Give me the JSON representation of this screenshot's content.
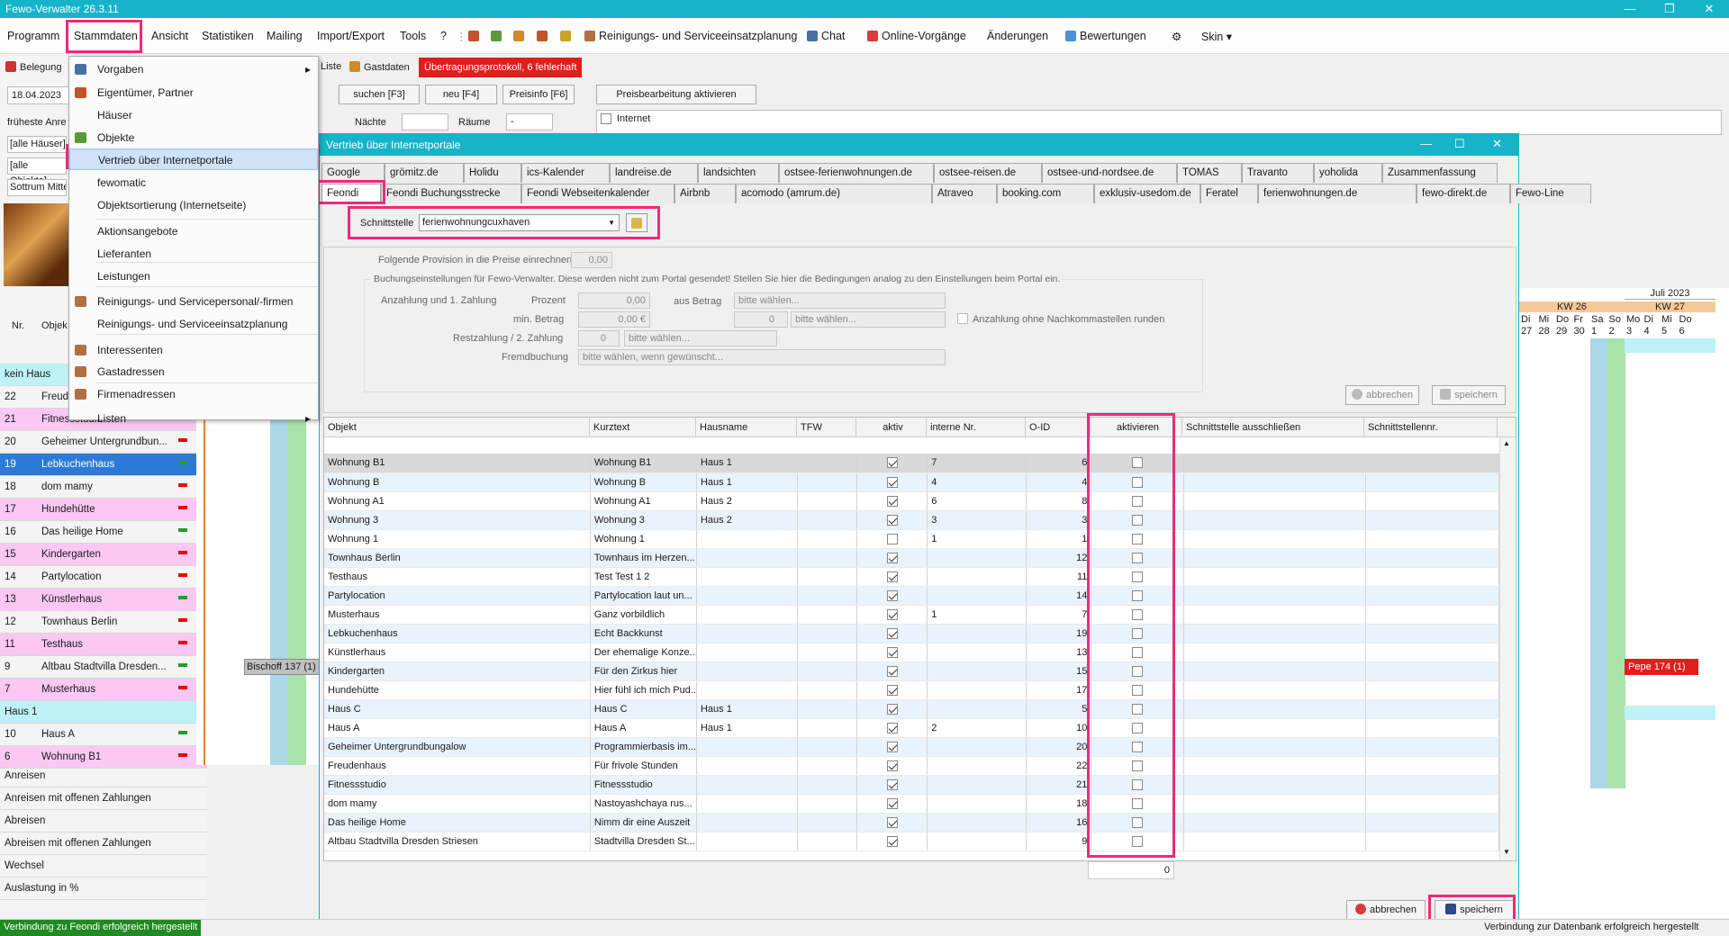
{
  "app": {
    "title": "Fewo-Verwalter 26.3.11"
  },
  "menu": {
    "items": [
      "Programm",
      "Stammdaten",
      "Ansicht",
      "Statistiken",
      "Mailing",
      "Import/Export",
      "Tools",
      "?"
    ],
    "reinigung": "Reinigungs- und Serviceeinsatzplanung",
    "chat": "Chat",
    "online": "Online-Vorgänge",
    "aenderungen": "Änderungen",
    "bewertungen": "Bewertungen",
    "skin": "Skin"
  },
  "dropdown": [
    {
      "label": "Vorgaben",
      "arrow": true,
      "icon": true
    },
    {
      "label": "Eigentümer, Partner",
      "icon": true
    },
    {
      "label": "Häuser"
    },
    {
      "label": "Objekte",
      "icon": true
    },
    {
      "label": "Vertrieb über Internetportale",
      "selected": true
    },
    {
      "label": "fewomatic"
    },
    {
      "label": "Objektsortierung (Internetseite)"
    },
    {
      "label": "Aktionsangebote"
    },
    {
      "label": "Lieferanten"
    },
    {
      "label": "Leistungen"
    },
    {
      "label": "Reinigungs- und Servicepersonal/-firmen",
      "icon": true
    },
    {
      "label": "Reinigungs- und Serviceeinsatzplanung"
    },
    {
      "label": "Interessenten",
      "icon": true
    },
    {
      "label": "Gastadressen",
      "icon": true
    },
    {
      "label": "Firmenadressen",
      "icon": true
    },
    {
      "label": "Listen",
      "arrow": true
    }
  ],
  "left": {
    "belegung": "Belegung",
    "date": "18.04.2023",
    "frueheste": "früheste Anre",
    "haeuser": "[alle Häuser]",
    "objekte": "[alle Objekte]",
    "sottrum": "Sottrum Mitte",
    "col_nr": "Nr.",
    "col_obj": "Objek"
  },
  "toolbar2": {
    "liste": "Liste",
    "gastdaten": "Gastdaten",
    "protokoll": "Übertragungsprotokoll, 6 fehlerhaft",
    "suchen": "suchen [F3]",
    "neu": "neu [F4]",
    "preisinfo": "Preisinfo [F6]",
    "preisbearbeitung": "Preisbearbeitung aktivieren",
    "naechte": "Nächte",
    "raeume": "Räume",
    "raeume_val": "-",
    "internet": "Internet"
  },
  "rows": [
    {
      "label": "kein Haus",
      "group": true
    },
    {
      "n": "22",
      "o": "Freud"
    },
    {
      "n": "21",
      "o": "Fitnessstudio",
      "pink": true
    },
    {
      "n": "20",
      "o": "Geheimer Untergrundbun..."
    },
    {
      "n": "19",
      "o": "Lebkuchenhaus",
      "sel": true
    },
    {
      "n": "18",
      "o": "dom mamy"
    },
    {
      "n": "17",
      "o": "Hundehütte",
      "pink": true
    },
    {
      "n": "16",
      "o": "Das heilige Home"
    },
    {
      "n": "15",
      "o": "Kindergarten",
      "pink": true
    },
    {
      "n": "14",
      "o": "Partylocation"
    },
    {
      "n": "13",
      "o": "Künstlerhaus",
      "pink": true
    },
    {
      "n": "12",
      "o": "Townhaus Berlin"
    },
    {
      "n": "11",
      "o": "Testhaus",
      "pink": true
    },
    {
      "n": "9",
      "o": "Altbau Stadtvilla Dresden..."
    },
    {
      "n": "7",
      "o": "Musterhaus",
      "pink": true
    },
    {
      "label": "Haus 1",
      "group": true
    },
    {
      "n": "10",
      "o": "Haus A"
    },
    {
      "n": "6",
      "o": "Wohnung B1",
      "pink": true
    }
  ],
  "stats": [
    "Anreisen",
    "Anreisen mit offenen Zahlungen",
    "Abreisen",
    "Abreisen mit offenen Zahlungen",
    "Wechsel",
    "Auslastung in %"
  ],
  "booking_bar": "Bischoff 137 (1)",
  "pepe": "Pepe  174 (1)",
  "calendar": {
    "month": "Juli 2023",
    "kw26": "KW 26",
    "kw27": "KW 27",
    "days": [
      "Di",
      "Mi",
      "Do",
      "Fr",
      "Sa",
      "So",
      "Mo",
      "Di",
      "Mi",
      "Do"
    ],
    "dates": [
      "27",
      "28",
      "29",
      "30",
      "1",
      "2",
      "3",
      "4",
      "5",
      "6"
    ]
  },
  "dialog": {
    "title": "Vertrieb über Internetportale",
    "tabs1": [
      "Google",
      "grömitz.de",
      "Holidu",
      "ics-Kalender",
      "landreise.de",
      "landsichten",
      "ostsee-ferienwohnungen.de",
      "ostsee-reisen.de",
      "ostsee-und-nordsee.de",
      "TOMAS",
      "Travanto",
      "yoholida",
      "Zusammenfassung"
    ],
    "tabs2": [
      "Feondi",
      "Feondi Buchungsstrecke",
      "Feondi Webseitenkalender",
      "Airbnb",
      "acomodo (amrum.de)",
      "Atraveo",
      "booking.com",
      "exklusiv-usedom.de",
      "Feratel",
      "ferienwohnungen.de",
      "fewo-direkt.de",
      "Fewo-Line"
    ],
    "schnittstelle_label": "Schnittstelle",
    "schnittstelle_value": "ferienwohnungcuxhaven",
    "provision_label": "Folgende Provision in die Preise einrechnen",
    "provision_value": "0,00",
    "buchung_note": "Buchungseinstellungen für Fewo-Verwalter. Diese werden nicht zum Portal gesendet! Stellen Sie hier die Bedingungen analog zu den Einstellungen beim Portal ein.",
    "anzahlung": "Anzahlung und 1. Zahlung",
    "prozent": "Prozent",
    "prozent_val": "0,00",
    "aus_betrag": "aus Betrag",
    "bitte": "bitte wählen...",
    "min_betrag": "min. Betrag",
    "min_val": "0,00 €",
    "zero": "0",
    "ohne_nk": "Anzahlung ohne Nachkommastellen runden",
    "restzahlung": "Restzahlung / 2. Zahlung",
    "fremdbuchung": "Fremdbuchung",
    "fremd_val": "bitte wählen, wenn gewünscht...",
    "abbrechen": "abbrechen",
    "speichern": "speichern",
    "columns": [
      "Objekt",
      "Kurztext",
      "Hausname",
      "TFW",
      "aktiv",
      "interne Nr.",
      "O-ID",
      "aktivieren",
      "Schnittstelle ausschließen",
      "Schnittstellennr."
    ],
    "rows": [
      {
        "o": "Wohnung B1",
        "k": "Wohnung B1",
        "h": "Haus 1",
        "a": true,
        "i": "7",
        "id": "6"
      },
      {
        "o": "Wohnung B",
        "k": "Wohnung B",
        "h": "Haus 1",
        "a": true,
        "i": "4",
        "id": "4"
      },
      {
        "o": "Wohnung A1",
        "k": "Wohnung A1",
        "h": "Haus 2",
        "a": true,
        "i": "6",
        "id": "8"
      },
      {
        "o": "Wohnung 3",
        "k": "Wohnung 3",
        "h": "Haus 2",
        "a": true,
        "i": "3",
        "id": "3"
      },
      {
        "o": "Wohnung 1",
        "k": "Wohnung 1",
        "h": "",
        "a": false,
        "i": "1",
        "id": "1"
      },
      {
        "o": "Townhaus Berlin",
        "k": "Townhaus im Herzen...",
        "h": "",
        "a": true,
        "i": "",
        "id": "12"
      },
      {
        "o": "Testhaus",
        "k": "Test Test 1 2",
        "h": "",
        "a": true,
        "i": "",
        "id": "11"
      },
      {
        "o": "Partylocation",
        "k": "Partylocation laut un...",
        "h": "",
        "a": true,
        "i": "",
        "id": "14"
      },
      {
        "o": "Musterhaus",
        "k": "Ganz vorbildlich",
        "h": "",
        "a": true,
        "i": "1",
        "id": "7"
      },
      {
        "o": "Lebkuchenhaus",
        "k": "Echt Backkunst",
        "h": "",
        "a": true,
        "i": "",
        "id": "19"
      },
      {
        "o": "Künstlerhaus",
        "k": "Der ehemalige Konze...",
        "h": "",
        "a": true,
        "i": "",
        "id": "13"
      },
      {
        "o": "Kindergarten",
        "k": "Für den Zirkus hier",
        "h": "",
        "a": true,
        "i": "",
        "id": "15"
      },
      {
        "o": "Hundehütte",
        "k": "Hier fühl ich mich Pud...",
        "h": "",
        "a": true,
        "i": "",
        "id": "17"
      },
      {
        "o": "Haus C",
        "k": "Haus C",
        "h": "Haus 1",
        "a": true,
        "i": "",
        "id": "5"
      },
      {
        "o": "Haus A",
        "k": "Haus A",
        "h": "Haus 1",
        "a": true,
        "i": "2",
        "id": "10"
      },
      {
        "o": "Geheimer Untergrundbungalow",
        "k": "Programmierbasis im...",
        "h": "",
        "a": true,
        "i": "",
        "id": "20"
      },
      {
        "o": "Freudenhaus",
        "k": "Für frivole Stunden",
        "h": "",
        "a": true,
        "i": "",
        "id": "22"
      },
      {
        "o": "Fitnessstudio",
        "k": "Fitnessstudio",
        "h": "",
        "a": true,
        "i": "",
        "id": "21"
      },
      {
        "o": "dom mamy",
        "k": "Nastoyashchaya rus...",
        "h": "",
        "a": true,
        "i": "",
        "id": "18"
      },
      {
        "o": "Das heilige Home",
        "k": "Nimm dir eine Auszeit",
        "h": "",
        "a": true,
        "i": "",
        "id": "16"
      },
      {
        "o": "Altbau Stadtvilla Dresden Striesen",
        "k": "Stadtvilla Dresden St...",
        "h": "",
        "a": true,
        "i": "",
        "id": "9"
      }
    ],
    "count": "0"
  },
  "status": {
    "left": "Verbindung zu Feondi erfolgreich hergestellt",
    "right": "Verbindung zur Datenbank erfolgreich hergestellt"
  }
}
